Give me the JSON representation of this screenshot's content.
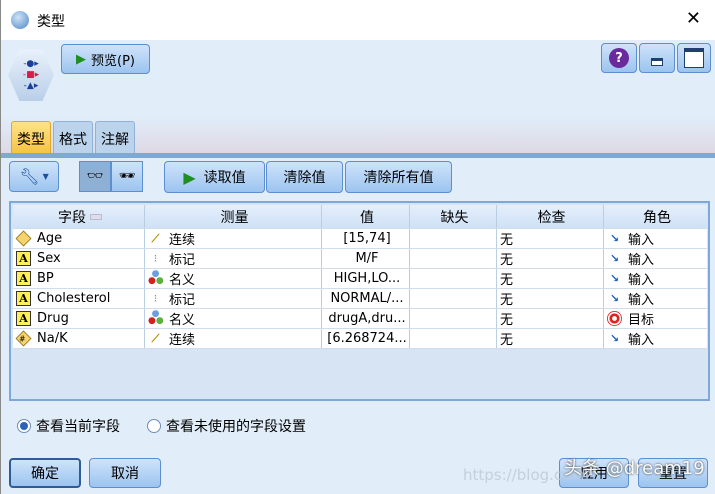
{
  "window": {
    "title": "类型",
    "close": "✕"
  },
  "toolbar": {
    "preview": "预览(P)",
    "read_values": "读取值",
    "clear_values": "清除值",
    "clear_all_values": "清除所有值",
    "help": "?"
  },
  "tabs": [
    "类型",
    "格式",
    "注解"
  ],
  "table": {
    "headers": [
      "字段",
      "测量",
      "值",
      "缺失",
      "检查",
      "角色"
    ],
    "rows": [
      {
        "field": "Age",
        "field_icon": "continuous-diamond",
        "measure": "连续",
        "measure_icon": "ruler",
        "value": "[15,74]",
        "missing": "",
        "check": "无",
        "role": "输入",
        "role_icon": "input-arrow"
      },
      {
        "field": "Sex",
        "field_icon": "string-A",
        "measure": "标记",
        "measure_icon": "flag",
        "value": "M/F",
        "missing": "",
        "check": "无",
        "role": "输入",
        "role_icon": "input-arrow"
      },
      {
        "field": "BP",
        "field_icon": "string-A",
        "measure": "名义",
        "measure_icon": "nominal-balls",
        "value": "HIGH,LO...",
        "missing": "",
        "check": "无",
        "role": "输入",
        "role_icon": "input-arrow"
      },
      {
        "field": "Cholesterol",
        "field_icon": "string-A",
        "measure": "标记",
        "measure_icon": "flag",
        "value": "NORMAL/...",
        "missing": "",
        "check": "无",
        "role": "输入",
        "role_icon": "input-arrow"
      },
      {
        "field": "Drug",
        "field_icon": "string-A",
        "measure": "名义",
        "measure_icon": "nominal-balls",
        "value": "drugA,dru...",
        "missing": "",
        "check": "无",
        "role": "目标",
        "role_icon": "target"
      },
      {
        "field": "Na/K",
        "field_icon": "numeric-hash",
        "measure": "连续",
        "measure_icon": "ruler",
        "value": "[6.268724...",
        "missing": "",
        "check": "无",
        "role": "输入",
        "role_icon": "input-arrow"
      }
    ]
  },
  "view_options": [
    {
      "label": "查看当前字段",
      "selected": true
    },
    {
      "label": "查看未使用的字段设置",
      "selected": false
    }
  ],
  "footer": {
    "ok": "确定",
    "cancel": "取消",
    "apply": "应用",
    "reset": "重置"
  },
  "watermark": {
    "text": "头条 @dream19",
    "url": "https://blog.csdn"
  }
}
